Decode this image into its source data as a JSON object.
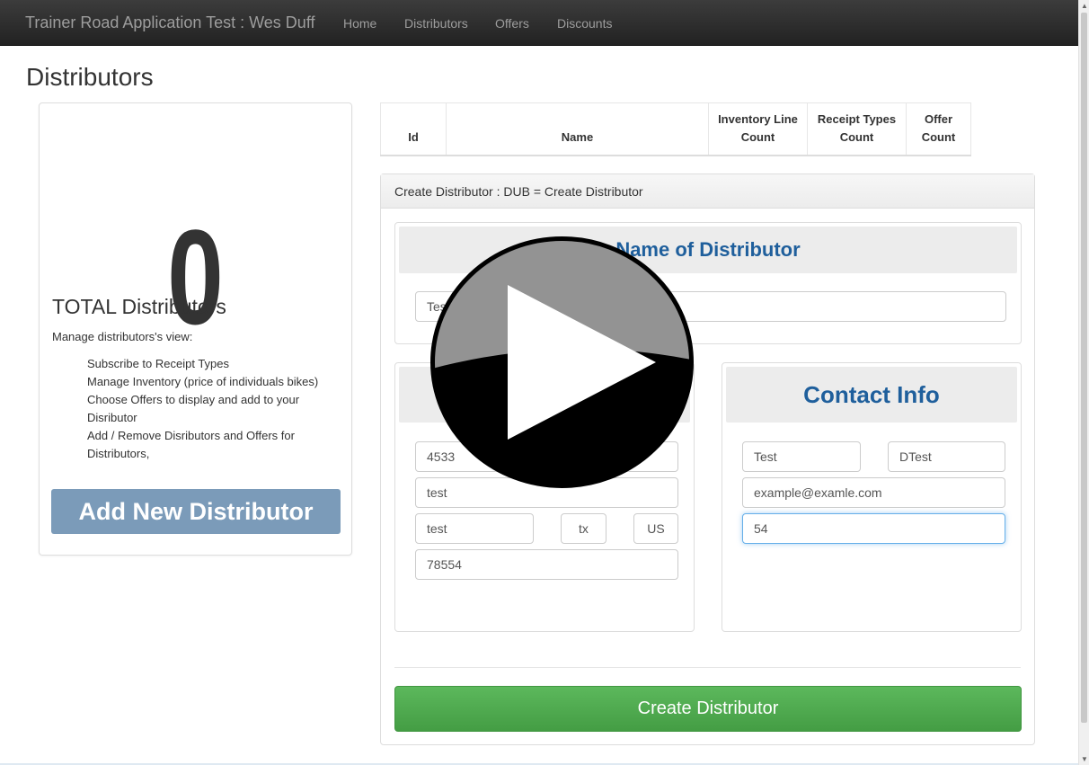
{
  "navbar": {
    "brand": "Trainer Road Application Test : Wes Duff",
    "links": [
      "Home",
      "Distributors",
      "Offers",
      "Discounts"
    ]
  },
  "page": {
    "title": "Distributors"
  },
  "summary": {
    "count": "0",
    "label": "TOTAL Distributors",
    "description": "Manage distributors's view:",
    "features": [
      "Subscribe to Receipt Types",
      "Manage Inventory (price of individuals bikes)",
      "Choose Offers to display and add to your Disributor",
      "Add / Remove Disributors and Offers for Distributors,"
    ],
    "add_button": "Add New Distributor"
  },
  "table": {
    "headers": [
      "Id",
      "Name",
      "Inventory Line Count",
      "Receipt Types Count",
      "Offer Count"
    ]
  },
  "create_form": {
    "heading": "Create Distributor : DUB = Create Distributor",
    "name_section": {
      "heading": "Name of Distributor",
      "name_value": "Test"
    },
    "address_section": {
      "street": "4533",
      "street2": "test",
      "city": "test",
      "state": "tx",
      "country": "US",
      "zip": "78554"
    },
    "contact_section": {
      "heading": "Contact Info",
      "first_name": "Test",
      "last_name": "DTest",
      "email": "example@examle.com",
      "phone": "54"
    },
    "submit_label": "Create Distributor"
  },
  "overlay": {
    "icon": "play-icon"
  }
}
